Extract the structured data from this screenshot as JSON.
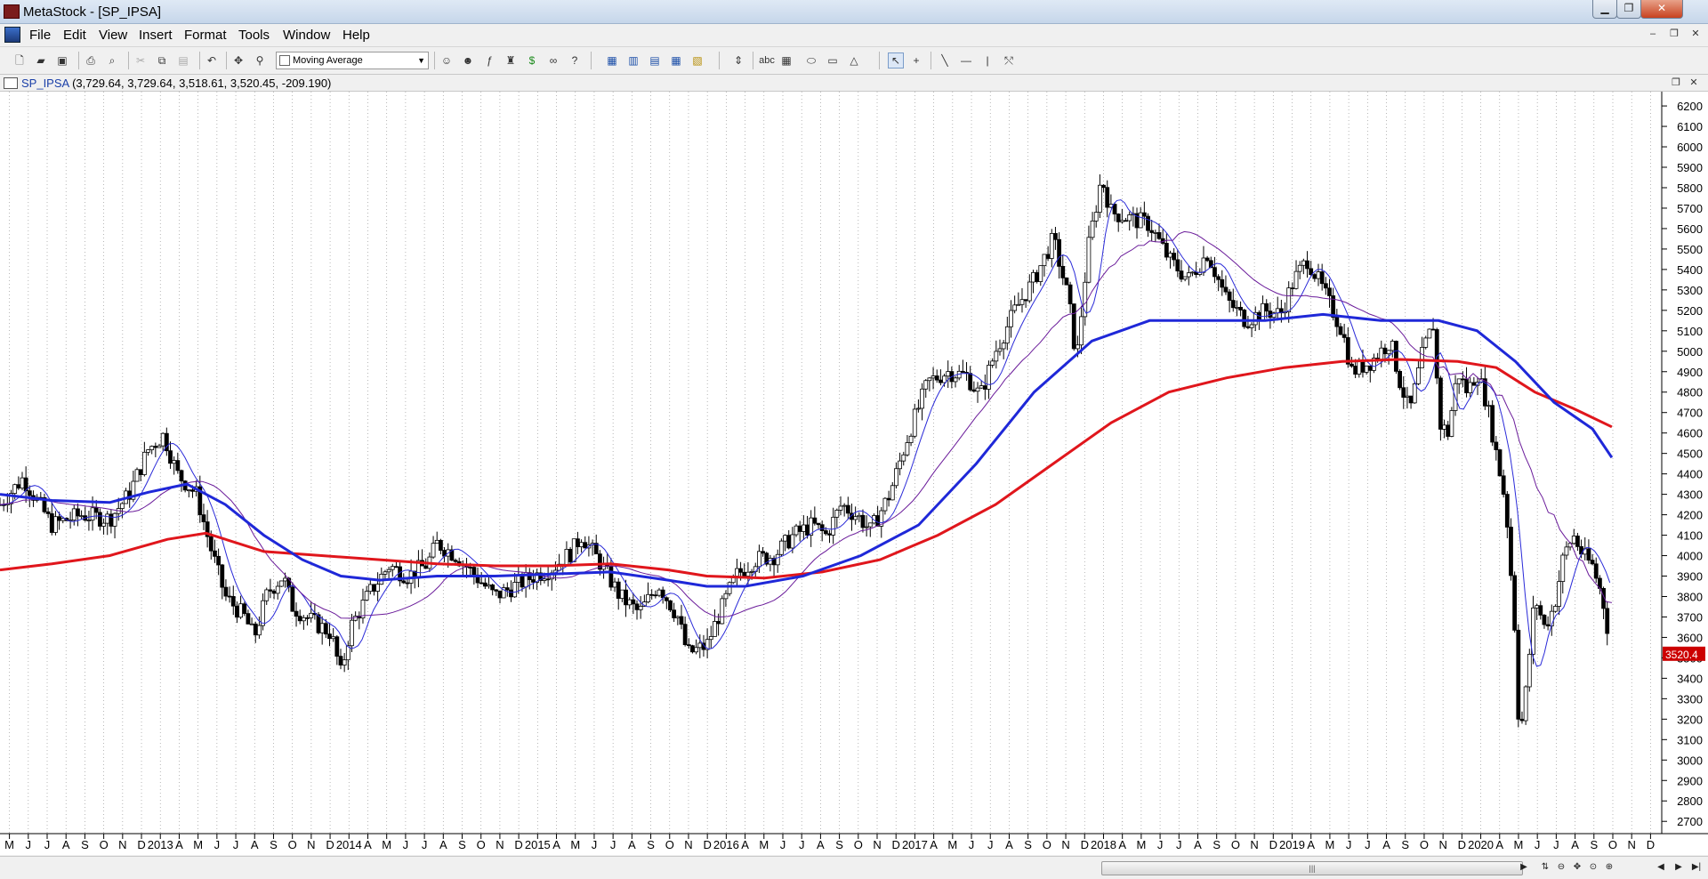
{
  "window": {
    "title": "MetaStock - [SP_IPSA]"
  },
  "menu": [
    "File",
    "Edit",
    "View",
    "Insert",
    "Format",
    "Tools",
    "Window",
    "Help"
  ],
  "toolbar": {
    "indicator_select": "Moving Average"
  },
  "chart_header": {
    "symbol": "SP_IPSA",
    "values": " (3,729.64, 3,729.64, 3,518.61, 3,520.45, -209.190)"
  },
  "colors": {
    "ma_fast": "#1f28d8",
    "ma_200": "#e0161c",
    "ma_thin": "#2a2ad8",
    "ma_purple": "#6a1b9a",
    "last_price_bg": "#cc0000"
  },
  "chart_data": {
    "type": "candlestick",
    "yaxis_ticks": [
      2700,
      2800,
      2900,
      3000,
      3100,
      3200,
      3300,
      3400,
      3500,
      3600,
      3700,
      3800,
      3900,
      4000,
      4100,
      4200,
      4300,
      4400,
      4500,
      4600,
      4700,
      4800,
      4900,
      5000,
      5100,
      5200,
      5300,
      5400,
      5500,
      5600,
      5700,
      5800,
      5900,
      6000,
      6100,
      6200
    ],
    "ylim": [
      2640,
      6270
    ],
    "last_price_label": "3520.4",
    "xaxis_labels": [
      "M",
      "J",
      "J",
      "A",
      "S",
      "O",
      "N",
      "D",
      "2013",
      "A",
      "M",
      "J",
      "J",
      "A",
      "S",
      "O",
      "N",
      "D",
      "2014",
      "A",
      "M",
      "J",
      "J",
      "A",
      "S",
      "O",
      "N",
      "D",
      "2015",
      "A",
      "M",
      "J",
      "J",
      "A",
      "S",
      "O",
      "N",
      "D",
      "2016",
      "A",
      "M",
      "J",
      "J",
      "A",
      "S",
      "O",
      "N",
      "D",
      "2017",
      "A",
      "M",
      "J",
      "J",
      "A",
      "S",
      "O",
      "N",
      "D",
      "2018",
      "A",
      "M",
      "J",
      "J",
      "A",
      "S",
      "O",
      "N",
      "D",
      "2019",
      "A",
      "M",
      "J",
      "J",
      "A",
      "S",
      "O",
      "N",
      "D",
      "2020",
      "A",
      "M",
      "J",
      "J",
      "A",
      "S",
      "O",
      "N",
      "D"
    ],
    "price_series": {
      "name": "SP_IPSA",
      "approx_close_path": [
        [
          2012.33,
          4250
        ],
        [
          2012.45,
          4380
        ],
        [
          2012.6,
          4150
        ],
        [
          2012.75,
          4200
        ],
        [
          2012.9,
          4180
        ],
        [
          2013.0,
          4300
        ],
        [
          2013.1,
          4520
        ],
        [
          2013.18,
          4590
        ],
        [
          2013.25,
          4400
        ],
        [
          2013.35,
          4300
        ],
        [
          2013.42,
          4050
        ],
        [
          2013.5,
          3800
        ],
        [
          2013.6,
          3700
        ],
        [
          2013.65,
          3600
        ],
        [
          2013.72,
          3820
        ],
        [
          2013.8,
          3900
        ],
        [
          2013.85,
          3750
        ],
        [
          2013.95,
          3680
        ],
        [
          2014.05,
          3620
        ],
        [
          2014.1,
          3420
        ],
        [
          2014.15,
          3650
        ],
        [
          2014.25,
          3820
        ],
        [
          2014.35,
          3950
        ],
        [
          2014.45,
          3900
        ],
        [
          2014.55,
          3960
        ],
        [
          2014.6,
          4060
        ],
        [
          2014.7,
          4000
        ],
        [
          2014.8,
          3900
        ],
        [
          2014.9,
          3800
        ],
        [
          2015.0,
          3850
        ],
        [
          2015.1,
          3900
        ],
        [
          2015.2,
          3940
        ],
        [
          2015.3,
          4020
        ],
        [
          2015.35,
          4100
        ],
        [
          2015.45,
          3960
        ],
        [
          2015.55,
          3800
        ],
        [
          2015.65,
          3720
        ],
        [
          2015.75,
          3860
        ],
        [
          2015.85,
          3700
        ],
        [
          2015.9,
          3520
        ],
        [
          2016.0,
          3560
        ],
        [
          2016.05,
          3680
        ],
        [
          2016.15,
          3900
        ],
        [
          2016.25,
          3980
        ],
        [
          2016.35,
          4000
        ],
        [
          2016.45,
          4100
        ],
        [
          2016.55,
          4150
        ],
        [
          2016.62,
          4100
        ],
        [
          2016.7,
          4250
        ],
        [
          2016.8,
          4180
        ],
        [
          2016.85,
          4120
        ],
        [
          2016.95,
          4300
        ],
        [
          2017.05,
          4600
        ],
        [
          2017.15,
          4850
        ],
        [
          2017.25,
          4900
        ],
        [
          2017.35,
          4880
        ],
        [
          2017.42,
          4780
        ],
        [
          2017.5,
          5000
        ],
        [
          2017.6,
          5200
        ],
        [
          2017.7,
          5350
        ],
        [
          2017.8,
          5550
        ],
        [
          2017.88,
          5250
        ],
        [
          2017.92,
          4950
        ],
        [
          2017.98,
          5500
        ],
        [
          2018.05,
          5850
        ],
        [
          2018.1,
          5680
        ],
        [
          2018.2,
          5650
        ],
        [
          2018.3,
          5620
        ],
        [
          2018.4,
          5450
        ],
        [
          2018.5,
          5350
        ],
        [
          2018.6,
          5480
        ],
        [
          2018.7,
          5250
        ],
        [
          2018.8,
          5150
        ],
        [
          2018.9,
          5200
        ],
        [
          2018.98,
          5180
        ],
        [
          2019.05,
          5350
        ],
        [
          2019.12,
          5450
        ],
        [
          2019.2,
          5300
        ],
        [
          2019.3,
          5100
        ],
        [
          2019.35,
          4900
        ],
        [
          2019.45,
          4950
        ],
        [
          2019.55,
          5050
        ],
        [
          2019.6,
          4850
        ],
        [
          2019.65,
          4700
        ],
        [
          2019.72,
          5000
        ],
        [
          2019.78,
          5150
        ],
        [
          2019.8,
          4650
        ],
        [
          2019.85,
          4600
        ],
        [
          2019.9,
          4900
        ],
        [
          2019.95,
          4800
        ],
        [
          2020.0,
          4900
        ],
        [
          2020.05,
          4750
        ],
        [
          2020.1,
          4500
        ],
        [
          2020.15,
          4250
        ],
        [
          2020.2,
          3600
        ],
        [
          2020.22,
          3100
        ],
        [
          2020.25,
          3300
        ],
        [
          2020.3,
          3800
        ],
        [
          2020.35,
          3650
        ],
        [
          2020.4,
          3750
        ],
        [
          2020.45,
          4000
        ],
        [
          2020.5,
          4100
        ],
        [
          2020.55,
          4000
        ],
        [
          2020.6,
          3950
        ],
        [
          2020.65,
          3800
        ],
        [
          2020.7,
          3520
        ]
      ]
    },
    "series": [
      {
        "color": "#e0161c",
        "points": [
          [
            2012.33,
            3930
          ],
          [
            2012.6,
            3960
          ],
          [
            2012.9,
            4000
          ],
          [
            2013.2,
            4080
          ],
          [
            2013.4,
            4110
          ],
          [
            2013.7,
            4020
          ],
          [
            2014.0,
            4000
          ],
          [
            2014.3,
            3980
          ],
          [
            2014.6,
            3960
          ],
          [
            2014.9,
            3950
          ],
          [
            2015.2,
            3950
          ],
          [
            2015.5,
            3960
          ],
          [
            2015.8,
            3930
          ],
          [
            2016.0,
            3900
          ],
          [
            2016.3,
            3890
          ],
          [
            2016.6,
            3920
          ],
          [
            2016.9,
            3980
          ],
          [
            2017.2,
            4100
          ],
          [
            2017.5,
            4250
          ],
          [
            2017.8,
            4450
          ],
          [
            2018.1,
            4650
          ],
          [
            2018.4,
            4800
          ],
          [
            2018.7,
            4870
          ],
          [
            2019.0,
            4920
          ],
          [
            2019.3,
            4950
          ],
          [
            2019.6,
            4960
          ],
          [
            2019.9,
            4950
          ],
          [
            2020.1,
            4920
          ],
          [
            2020.3,
            4800
          ],
          [
            2020.5,
            4720
          ],
          [
            2020.7,
            4630
          ]
        ]
      },
      {
        "color": "#1f28d8",
        "points": [
          [
            2012.33,
            4300
          ],
          [
            2012.6,
            4270
          ],
          [
            2012.9,
            4260
          ],
          [
            2013.1,
            4310
          ],
          [
            2013.3,
            4350
          ],
          [
            2013.5,
            4250
          ],
          [
            2013.7,
            4100
          ],
          [
            2013.9,
            3980
          ],
          [
            2014.1,
            3900
          ],
          [
            2014.3,
            3880
          ],
          [
            2014.6,
            3900
          ],
          [
            2014.9,
            3900
          ],
          [
            2015.2,
            3910
          ],
          [
            2015.5,
            3920
          ],
          [
            2015.8,
            3880
          ],
          [
            2016.0,
            3850
          ],
          [
            2016.2,
            3850
          ],
          [
            2016.5,
            3900
          ],
          [
            2016.8,
            4000
          ],
          [
            2017.1,
            4150
          ],
          [
            2017.4,
            4450
          ],
          [
            2017.7,
            4800
          ],
          [
            2018.0,
            5050
          ],
          [
            2018.3,
            5150
          ],
          [
            2018.6,
            5150
          ],
          [
            2018.9,
            5150
          ],
          [
            2019.2,
            5180
          ],
          [
            2019.5,
            5150
          ],
          [
            2019.8,
            5150
          ],
          [
            2020.0,
            5100
          ],
          [
            2020.2,
            4950
          ],
          [
            2020.4,
            4750
          ],
          [
            2020.6,
            4620
          ],
          [
            2020.7,
            4480
          ]
        ]
      }
    ]
  },
  "scrollbar": {
    "thumb_label": "|||"
  }
}
